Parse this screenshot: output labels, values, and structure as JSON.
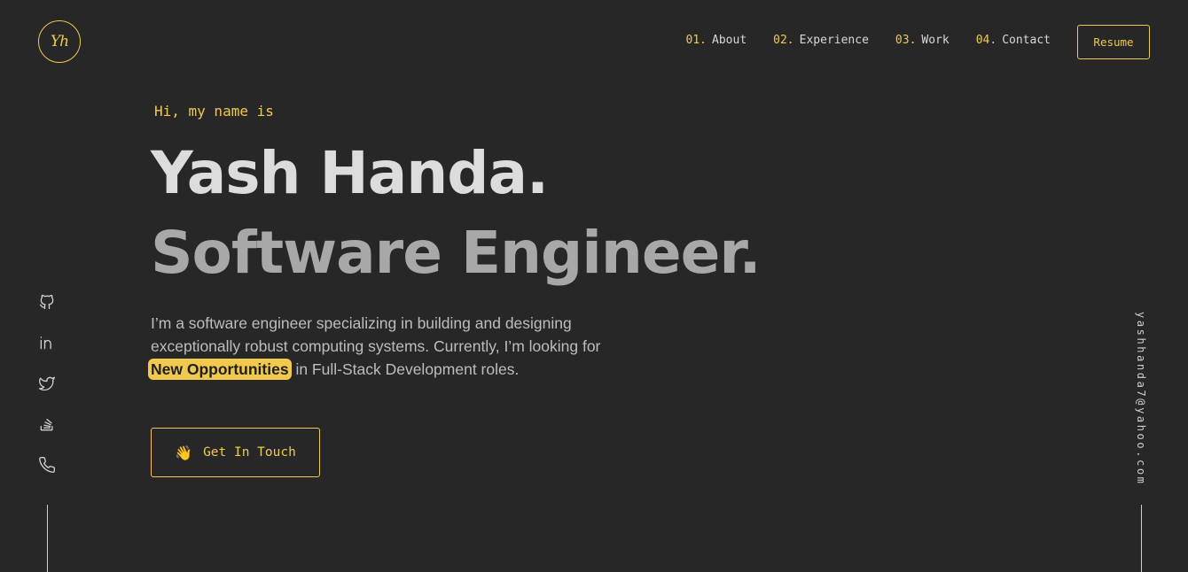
{
  "logo": {
    "text": "Yh"
  },
  "nav": {
    "items": [
      {
        "num": "01.",
        "label": "About"
      },
      {
        "num": "02.",
        "label": "Experience"
      },
      {
        "num": "03.",
        "label": "Work"
      },
      {
        "num": "04.",
        "label": "Contact"
      }
    ],
    "resume_label": "Resume"
  },
  "hero": {
    "greeting": "Hi, my name is",
    "name": "Yash Handa.",
    "title": "Software Engineer.",
    "desc_part1": "I’m a software engineer specializing in building and designing exceptionally robust computing systems. Currently, I’m looking for",
    "desc_highlight": "New Opportunities",
    "desc_part2": "in Full-Stack Development roles.",
    "cta_label": "Get In Touch",
    "cta_icon": "👋"
  },
  "social": [
    "github-icon",
    "linkedin-icon",
    "twitter-icon",
    "stackoverflow-icon",
    "phone-icon"
  ],
  "email": "yashhanda7@yahoo.com",
  "colors": {
    "background": "#282727",
    "accent": "#f2c94c"
  }
}
